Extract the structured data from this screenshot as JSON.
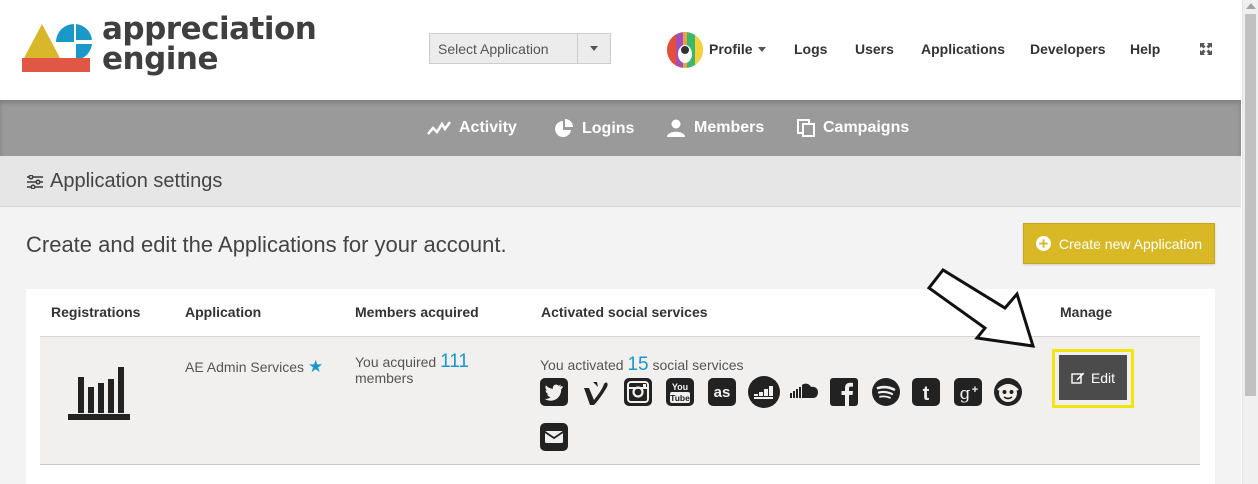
{
  "brand": {
    "line1": "appreciation",
    "line2": "engine"
  },
  "header": {
    "select_application": "Select Application",
    "profile": "Profile",
    "nav": [
      "Logs",
      "Users",
      "Applications",
      "Developers",
      "Help"
    ]
  },
  "subnav": {
    "activity": "Activity",
    "logins": "Logins",
    "members": "Members",
    "campaigns": "Campaigns"
  },
  "settings": {
    "title": "Application settings"
  },
  "main": {
    "lead": "Create and edit the Applications for your account.",
    "create_button": "Create new Application"
  },
  "table": {
    "headers": {
      "registrations": "Registrations",
      "application": "Application",
      "members_acquired": "Members acquired",
      "social_services": "Activated social services",
      "manage": "Manage"
    },
    "row": {
      "application_name": "AE Admin Services",
      "acquired_prefix": "You acquired",
      "acquired_count": "111",
      "acquired_suffix": "members",
      "activated_prefix": "You activated",
      "activated_count": "15",
      "activated_suffix": "social services",
      "social_icons": [
        "twitter-icon",
        "vine-icon",
        "instagram-icon",
        "youtube-icon",
        "lastfm-icon",
        "deezer-icon",
        "soundcloud-icon",
        "facebook-icon",
        "spotify-icon",
        "tumblr-icon",
        "google-plus-icon",
        "napster-icon",
        "email-icon"
      ],
      "edit_label": "Edit"
    }
  },
  "colors": {
    "accent": "#1a98c8",
    "create_button": "#d9b825",
    "highlight": "#f2e50b",
    "subnav": "#9a9a9a"
  }
}
